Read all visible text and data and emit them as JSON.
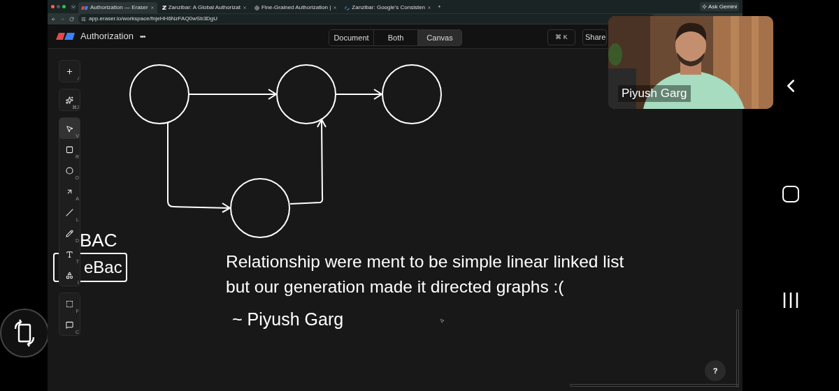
{
  "browser": {
    "tabs": [
      {
        "title": "Authorization — Eraser",
        "selected": true
      },
      {
        "title": "Zanzibar: A Global Authorizat",
        "selected": false
      },
      {
        "title": "Fine-Grained Authorization |",
        "selected": false
      },
      {
        "title": "Zanzibar: Google's Consisten",
        "selected": false
      }
    ],
    "new_tab": "+",
    "url": "app.eraser.io/workspace/fnjeHH6NzFAQ0wSb3DgU",
    "ask_gemini": "Ask Gemini"
  },
  "app": {
    "title": "Authorization",
    "more": "•••",
    "view_modes": [
      {
        "label": "Document",
        "selected": false
      },
      {
        "label": "Both",
        "selected": false
      },
      {
        "label": "Canvas",
        "selected": true
      }
    ],
    "command": "⌘ K",
    "share": "Share"
  },
  "toolbar": {
    "groups": [
      [
        {
          "kind": "plus",
          "shortcut": "/",
          "selected": false
        }
      ],
      [
        {
          "kind": "ai",
          "shortcut": "⌘J",
          "selected": false
        }
      ],
      [
        {
          "kind": "select",
          "shortcut": "V",
          "selected": true
        },
        {
          "kind": "rectangle",
          "shortcut": "R",
          "selected": false
        },
        {
          "kind": "circle",
          "shortcut": "O",
          "selected": false
        },
        {
          "kind": "arrow",
          "shortcut": "A",
          "selected": false
        },
        {
          "kind": "line",
          "shortcut": "L",
          "selected": false
        },
        {
          "kind": "pencil",
          "shortcut": "D",
          "selected": false
        },
        {
          "kind": "text",
          "shortcut": "T",
          "selected": false
        },
        {
          "kind": "shapes",
          "shortcut": "I",
          "selected": false
        }
      ],
      [
        {
          "kind": "frame",
          "shortcut": "F",
          "selected": false
        },
        {
          "kind": "comment",
          "shortcut": "C",
          "selected": false
        }
      ]
    ]
  },
  "canvas": {
    "labels": [
      {
        "text": "BAC",
        "boxed": false
      },
      {
        "text": "eBac",
        "boxed": true
      }
    ],
    "quote": [
      "Relationship were ment to be simple linear linked list",
      "but our generation made it directed graphs :("
    ],
    "signature": "~ Piyush Garg",
    "help": "?"
  },
  "webcam": {
    "name": "Piyush Garg"
  }
}
